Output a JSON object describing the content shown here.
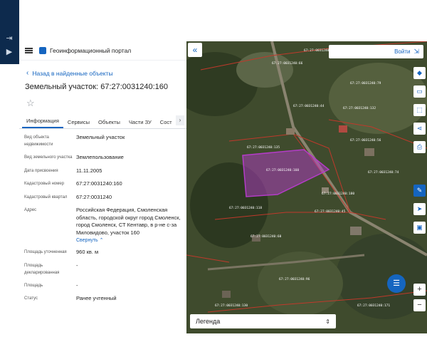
{
  "app": {
    "title": "Геоинформационный портал"
  },
  "nav": {
    "back": "Назад в найденные объекты"
  },
  "object": {
    "title": "Земельный участок: 67:27:0031240:160"
  },
  "tabs": [
    "Информация",
    "Сервисы",
    "Объекты",
    "Части ЗУ",
    "Сост"
  ],
  "fields": [
    {
      "label": "Вид объекта недвижимости",
      "value": "Земельный участок"
    },
    {
      "label": "Вид земельного участка",
      "value": "Землепользование"
    },
    {
      "label": "Дата присвоения",
      "value": "11.11.2005"
    },
    {
      "label": "Кадастровый номер",
      "value": "67:27:0031240:160"
    },
    {
      "label": "Кадастровый квартал",
      "value": "67:27:0031240"
    },
    {
      "label": "Адрес",
      "value": "Российская Федерация, Смоленская область, городской округ город Смоленск, город Смоленск, СТ Кентавр, в р-не с-за Миловидово, участок 160"
    },
    {
      "label": "Площадь уточненная",
      "value": "960 кв. м"
    },
    {
      "label": "Площадь декларированная",
      "value": "-"
    },
    {
      "label": "Площадь",
      "value": "-"
    },
    {
      "label": "Статус",
      "value": "Ранее учтенный"
    }
  ],
  "address_toggle": "Свернуть",
  "map": {
    "login": "Войти",
    "legend": "Легенда",
    "highlight_color": "#b43cc8",
    "boundary_color": "#c0392b",
    "parcel_labels": [
      "67:27:0031240:5",
      "67:27:0031240:66",
      "67:27:0031240:79",
      "67:27:0031240:44",
      "67:27:0031240:160",
      "67:27:0031240:135",
      "67:27:0031240:180",
      "67:27:0031240:56",
      "67:27:0031240:74",
      "67:27:0031240:118",
      "67:27:0031240:45",
      "67:27:0031240:60",
      "67:27:0031240:96",
      "67:27:0031240:130",
      "67:27:0031240:171",
      "67:27:0031240:132"
    ]
  },
  "tools": [
    "layers-icon",
    "card-icon",
    "select-area-icon",
    "share-icon",
    "print-icon"
  ]
}
